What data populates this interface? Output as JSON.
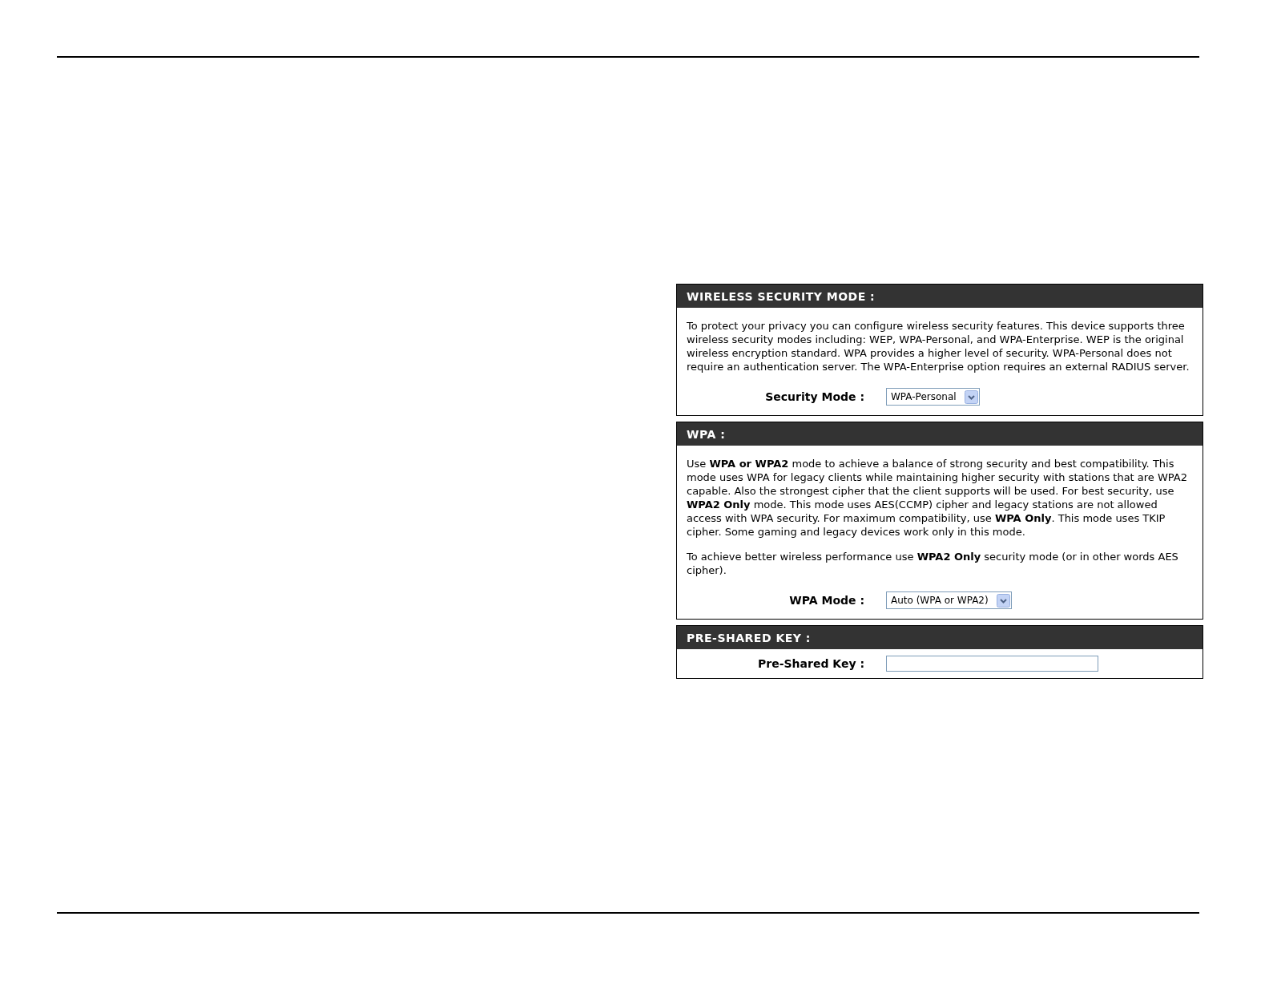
{
  "sections": [
    {
      "title": "WIRELESS SECURITY MODE :",
      "paragraphs": [
        "To protect your privacy you can configure wireless security features. This device supports three wireless security modes including: WEP, WPA-Personal, and WPA-Enterprise. WEP is the original wireless encryption standard. WPA provides a higher level of security. WPA-Personal does not require an authentication server. The WPA-Enterprise option requires an external RADIUS server."
      ],
      "fields": [
        {
          "kind": "select",
          "label": "Security Mode :",
          "value": "WPA-Personal"
        }
      ]
    },
    {
      "title": "WPA :",
      "paragraphs": [
        "Use **WPA or WPA2** mode to achieve a balance of strong security and best compatibility. This mode uses WPA for legacy clients while maintaining higher security with stations that are WPA2 capable. Also the strongest cipher that the client supports will be used. For best security, use **WPA2 Only** mode. This mode uses AES(CCMP) cipher and legacy stations are not allowed access with WPA security. For maximum compatibility, use **WPA Only**. This mode uses TKIP cipher. Some gaming and legacy devices work only in this mode.",
        "To achieve better wireless performance use **WPA2 Only** security mode (or in other words AES cipher)."
      ],
      "fields": [
        {
          "kind": "select",
          "label": "WPA Mode :",
          "value": "Auto (WPA or WPA2)"
        }
      ]
    },
    {
      "title": "PRE-SHARED KEY :",
      "fields": [
        {
          "kind": "text",
          "label": "Pre-Shared Key :"
        }
      ]
    }
  ]
}
